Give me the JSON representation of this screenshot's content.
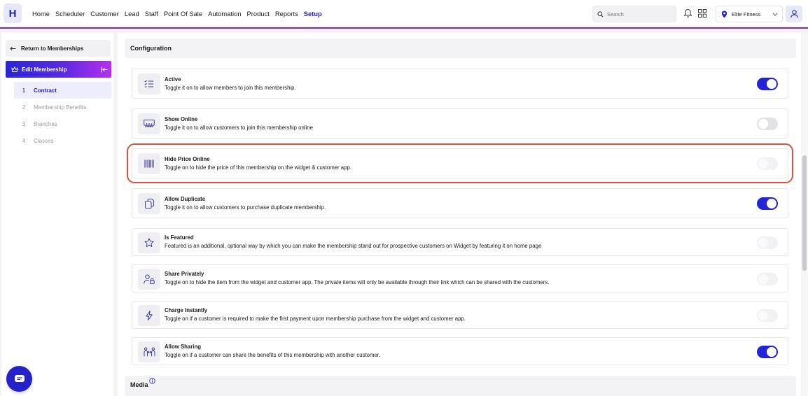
{
  "app": {
    "logo_letter": "H"
  },
  "nav": {
    "items": [
      {
        "label": "Home"
      },
      {
        "label": "Scheduler"
      },
      {
        "label": "Customer"
      },
      {
        "label": "Lead"
      },
      {
        "label": "Staff"
      },
      {
        "label": "Point Of Sale"
      },
      {
        "label": "Automation"
      },
      {
        "label": "Product"
      },
      {
        "label": "Reports"
      },
      {
        "label": "Setup",
        "active": true
      }
    ],
    "search_placeholder": "Search",
    "branch_name": "Elite Fitness"
  },
  "sidebar": {
    "back_label": "Return to Memberships",
    "edit_label": "Edit Membership",
    "steps": [
      {
        "num": "1",
        "label": "Contract",
        "active": true
      },
      {
        "num": "2",
        "label": "Membership Benefits"
      },
      {
        "num": "3",
        "label": "Branches"
      },
      {
        "num": "4",
        "label": "Classes"
      }
    ]
  },
  "main": {
    "section_title": "Configuration",
    "settings": [
      {
        "title": "Active",
        "desc": "Toggle it on to allow members to join this membership.",
        "icon": "checklist-icon",
        "enabled": true
      },
      {
        "title": "Show Online",
        "desc": "Toggle it on to allow customers to join this membership online",
        "icon": "online-screen-icon",
        "enabled": false
      },
      {
        "title": "Hide Price Online",
        "desc": "Toggle on to hide the price of this membership on the widget & customer app.",
        "icon": "barcode-icon",
        "enabled": false,
        "highlighted": true
      },
      {
        "title": "Allow Duplicate",
        "desc": "Toggle it on to allow customers to purchase duplicate membership.",
        "icon": "duplicate-icon",
        "enabled": true
      },
      {
        "title": "Is Featured",
        "desc": "Featured is an additional, optional way by which you can make the membership stand out for prospective customers on Widget by featuring it on home page",
        "icon": "star-icon",
        "enabled": false
      },
      {
        "title": "Share Privately",
        "desc": "Toggle on to hide the item from the widget and customer app. The private items will only be available through their link which can be shared with the customers.",
        "icon": "user-lock-icon",
        "enabled": false
      },
      {
        "title": "Charge Instantly",
        "desc": "Toggle on if a customer is required to make the first payment upon membership purchase from the widget and customer app.",
        "icon": "lightning-icon",
        "enabled": false
      },
      {
        "title": "Allow Sharing",
        "desc": "Toggle on if a customer can share the benefits of this membership with another customer.",
        "icon": "people-share-icon",
        "enabled": true
      }
    ],
    "media_title": "Media"
  },
  "colors": {
    "accent": "#2323d8",
    "highlight": "#d8543f"
  }
}
